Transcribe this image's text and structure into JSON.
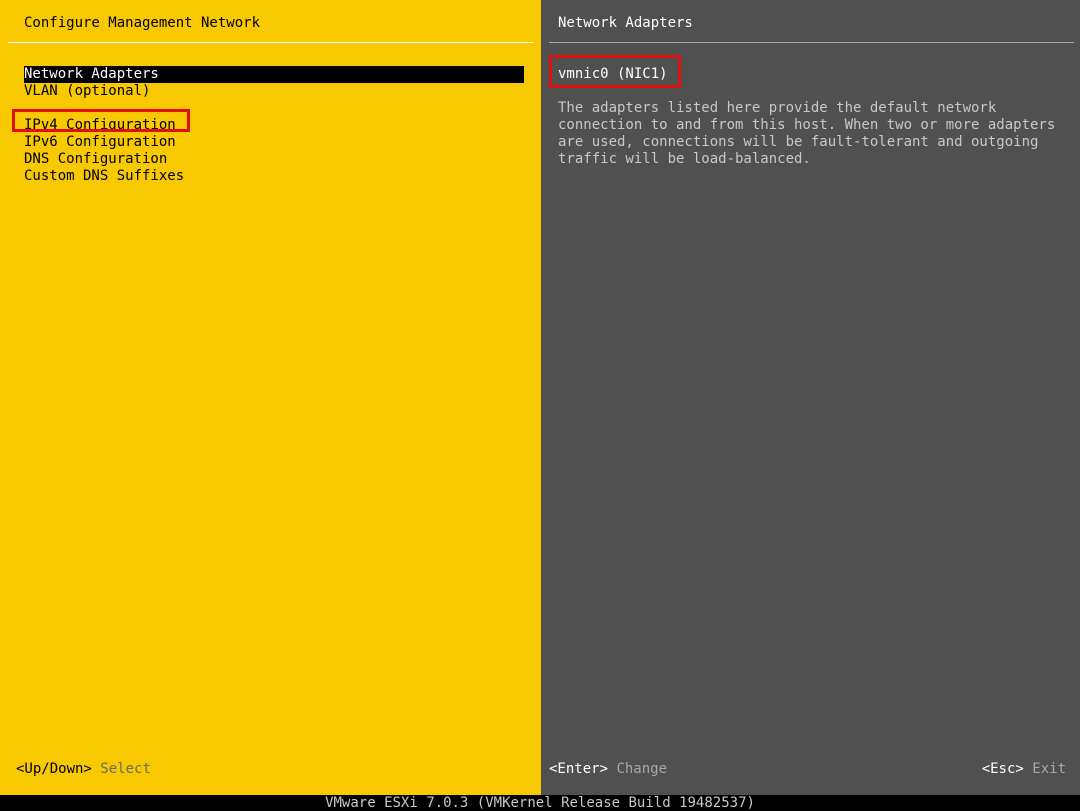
{
  "left_pane": {
    "title": "Configure Management Network",
    "menu": [
      {
        "label": "Network Adapters",
        "selected": true
      },
      {
        "label": "VLAN (optional)"
      },
      {
        "label": "IPv4 Configuration"
      },
      {
        "label": "IPv6 Configuration"
      },
      {
        "label": "DNS Configuration"
      },
      {
        "label": "Custom DNS Suffixes"
      }
    ],
    "hint_key": "<Up/Down>",
    "hint_action": "Select"
  },
  "right_pane": {
    "title": "Network Adapters",
    "adapter": "vmnic0 (NIC1)",
    "description_lines": [
      "The adapters listed here provide the default network",
      "connection to and from this host. When two or more adapters",
      "are used, connections will be fault-tolerant and outgoing",
      "traffic will be load-balanced."
    ],
    "enter_key": "<Enter>",
    "enter_action": "Change",
    "esc_key": "<Esc>",
    "esc_action": "Exit"
  },
  "footer": "VMware ESXi 7.0.3 (VMKernel Release Build 19482537)",
  "colors": {
    "left_background": "#f8c800",
    "right_background": "#505050",
    "highlight_box": "#e01010"
  }
}
